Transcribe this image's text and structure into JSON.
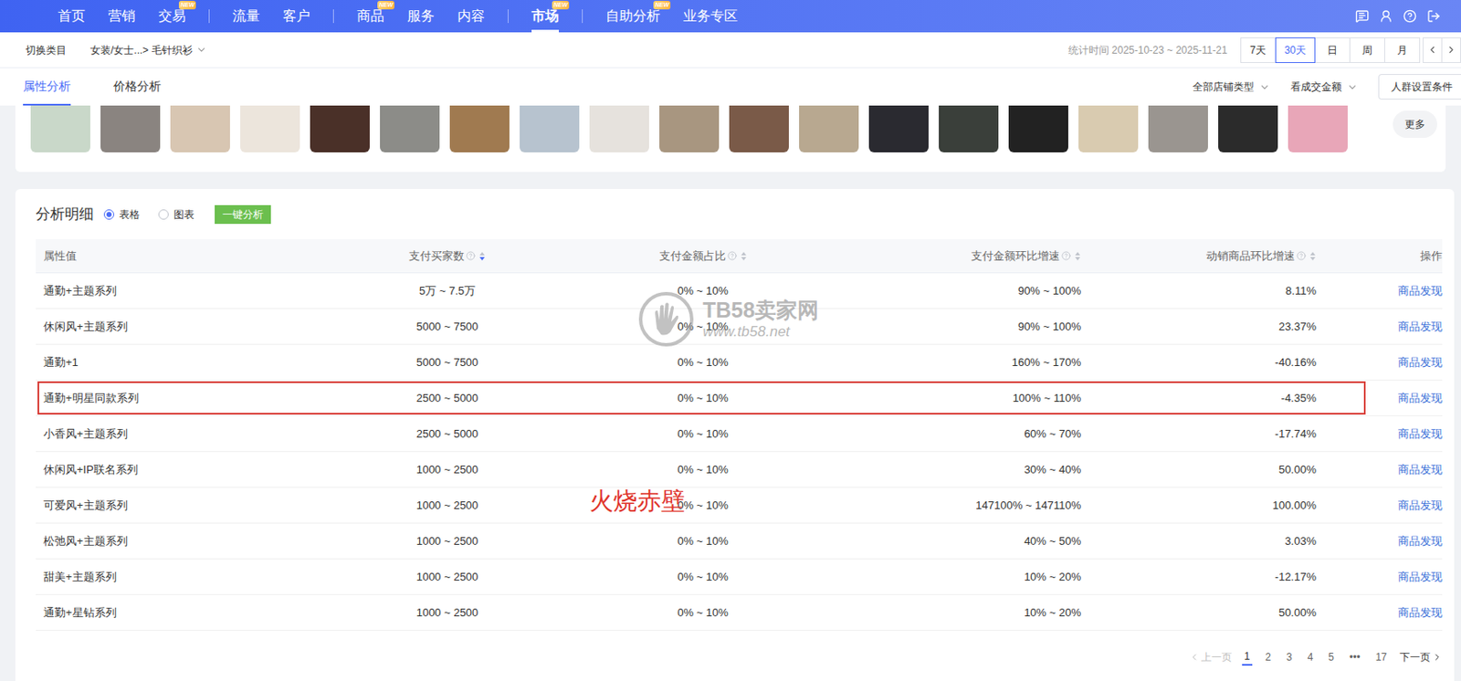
{
  "nav": {
    "items": [
      {
        "label": "首页",
        "selected": false,
        "divider_before": false
      },
      {
        "label": "营销",
        "selected": false,
        "divider_before": false
      },
      {
        "label": "交易",
        "selected": false,
        "divider_before": false,
        "badge": "NEW"
      },
      {
        "label": "流量",
        "selected": false,
        "divider_before": true
      },
      {
        "label": "客户",
        "selected": false,
        "divider_before": false
      },
      {
        "label": "商品",
        "selected": false,
        "divider_before": true,
        "badge": "NEW"
      },
      {
        "label": "服务",
        "selected": false,
        "divider_before": false
      },
      {
        "label": "内容",
        "selected": false,
        "divider_before": false
      },
      {
        "label": "市场",
        "selected": true,
        "divider_before": true,
        "badge": "NEW"
      },
      {
        "label": "自助分析",
        "selected": false,
        "divider_before": true,
        "badge": "NEW"
      },
      {
        "label": "业务专区",
        "selected": false,
        "divider_before": false
      }
    ]
  },
  "category_bar": {
    "switch": "切换类目",
    "path": "女装/女士...> 毛针织衫",
    "time_label": "统计时间 2025-10-23 ~ 2025-11-21",
    "ranges": [
      {
        "label": "7天",
        "selected": false
      },
      {
        "label": "30天",
        "selected": true
      },
      {
        "label": "日",
        "selected": false
      },
      {
        "label": "周",
        "selected": false
      },
      {
        "label": "月",
        "selected": false
      }
    ]
  },
  "tabs": [
    {
      "label": "属性分析",
      "selected": true
    },
    {
      "label": "价格分析",
      "selected": false
    }
  ],
  "filters": [
    {
      "label": "全部店铺类型"
    },
    {
      "label": "看成交金额"
    }
  ],
  "crowd_button": "人群设置条件",
  "thumbnails": [
    {
      "color": "#c9d8c9"
    },
    {
      "color": "#8a8480"
    },
    {
      "color": "#d8c6b2"
    },
    {
      "color": "#ece5dc"
    },
    {
      "color": "#4a3028"
    },
    {
      "color": "#8c8c88"
    },
    {
      "color": "#a07a50"
    },
    {
      "color": "#b7c3cf"
    },
    {
      "color": "#e6e2dd"
    },
    {
      "color": "#a89680"
    },
    {
      "color": "#7a5a48"
    },
    {
      "color": "#b8a890"
    },
    {
      "color": "#2a2a30"
    },
    {
      "color": "#3a3f3a"
    },
    {
      "color": "#222222"
    },
    {
      "color": "#d9cbb0"
    },
    {
      "color": "#9a9590"
    },
    {
      "color": "#2b2b2b"
    },
    {
      "color": "#e8a6b8"
    }
  ],
  "more": "更多",
  "panel": {
    "title": "分析明细",
    "views": [
      {
        "label": "表格",
        "selected": true
      },
      {
        "label": "图表",
        "selected": false
      }
    ],
    "analyze_button": "一键分析"
  },
  "table": {
    "columns": [
      {
        "label": "属性值",
        "help": false,
        "sortable": false,
        "sort": "none"
      },
      {
        "label": "支付买家数",
        "help": true,
        "sortable": true,
        "sort": "desc"
      },
      {
        "label": "支付金额占比",
        "help": true,
        "sortable": true,
        "sort": "none"
      },
      {
        "label": "支付金额环比增速",
        "help": true,
        "sortable": true,
        "sort": "none"
      },
      {
        "label": "动销商品环比增速",
        "help": true,
        "sortable": true,
        "sort": "none"
      },
      {
        "label": "操作",
        "help": false,
        "sortable": false,
        "sort": "none"
      }
    ],
    "rows": [
      {
        "cells": [
          "通勤+主题系列",
          "5万 ~ 7.5万",
          "0% ~ 10%",
          "90% ~ 100%",
          "8.11%"
        ],
        "action": "商品发现",
        "highlighted": false
      },
      {
        "cells": [
          "休闲风+主题系列",
          "5000 ~ 7500",
          "0% ~ 10%",
          "90% ~ 100%",
          "23.37%"
        ],
        "action": "商品发现",
        "highlighted": false
      },
      {
        "cells": [
          "通勤+1",
          "5000 ~ 7500",
          "0% ~ 10%",
          "160% ~ 170%",
          "-40.16%"
        ],
        "action": "商品发现",
        "highlighted": false
      },
      {
        "cells": [
          "通勤+明星同款系列",
          "2500 ~ 5000",
          "0% ~ 10%",
          "100% ~ 110%",
          "-4.35%"
        ],
        "action": "商品发现",
        "highlighted": true
      },
      {
        "cells": [
          "小香风+主题系列",
          "2500 ~ 5000",
          "0% ~ 10%",
          "60% ~ 70%",
          "-17.74%"
        ],
        "action": "商品发现",
        "highlighted": false
      },
      {
        "cells": [
          "休闲风+IP联名系列",
          "1000 ~ 2500",
          "0% ~ 10%",
          "30% ~ 40%",
          "50.00%"
        ],
        "action": "商品发现",
        "highlighted": false
      },
      {
        "cells": [
          "可爱风+主题系列",
          "1000 ~ 2500",
          "0% ~ 10%",
          "147100% ~ 147110%",
          "100.00%"
        ],
        "action": "商品发现",
        "highlighted": false
      },
      {
        "cells": [
          "松弛风+主题系列",
          "1000 ~ 2500",
          "0% ~ 10%",
          "40% ~ 50%",
          "3.03%"
        ],
        "action": "商品发现",
        "highlighted": false
      },
      {
        "cells": [
          "甜美+主题系列",
          "1000 ~ 2500",
          "0% ~ 10%",
          "10% ~ 20%",
          "-12.17%"
        ],
        "action": "商品发现",
        "highlighted": false
      },
      {
        "cells": [
          "通勤+星钻系列",
          "1000 ~ 2500",
          "0% ~ 10%",
          "10% ~ 20%",
          "50.00%"
        ],
        "action": "商品发现",
        "highlighted": false
      }
    ]
  },
  "pagination": {
    "prev": "上一页",
    "prev_disabled": true,
    "pages": [
      {
        "label": "1",
        "selected": true
      },
      {
        "label": "2",
        "selected": false
      },
      {
        "label": "3",
        "selected": false
      },
      {
        "label": "4",
        "selected": false
      },
      {
        "label": "5",
        "selected": false
      },
      {
        "label": "•••",
        "selected": false
      },
      {
        "label": "17",
        "selected": false
      }
    ],
    "next": "下一页"
  },
  "watermark": {
    "brand": "TB58卖家网",
    "url": "www.tb58.net"
  },
  "annotation": "火烧赤壁"
}
